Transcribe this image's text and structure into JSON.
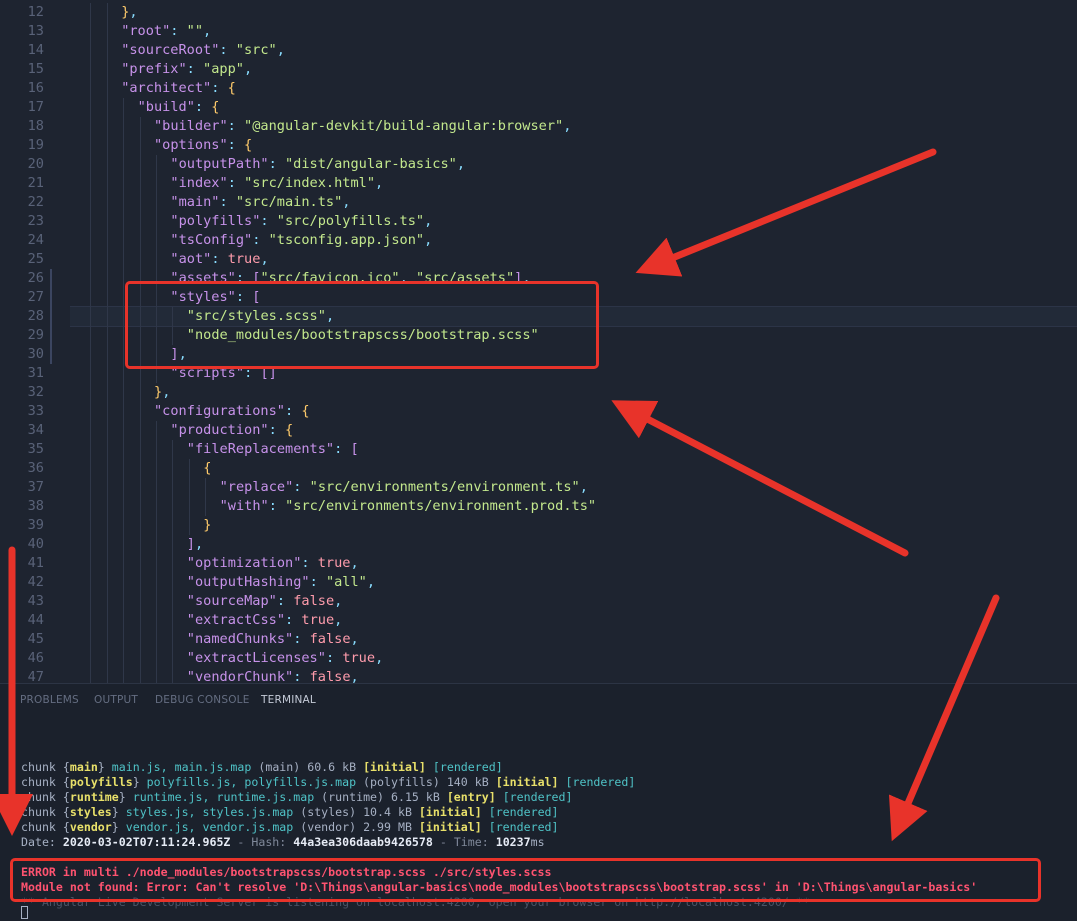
{
  "editor": {
    "lines": [
      {
        "n": "12",
        "html": "<span class='b'>}</span><span class='p'>,</span>",
        "indent": 3
      },
      {
        "n": "13",
        "html": "<span class='k'>\"root\"</span><span class='p'>:</span> <span class='s'>\"\"</span><span class='p'>,</span>",
        "indent": 3
      },
      {
        "n": "14",
        "html": "<span class='k'>\"sourceRoot\"</span><span class='p'>:</span> <span class='s'>\"src\"</span><span class='p'>,</span>",
        "indent": 3
      },
      {
        "n": "15",
        "html": "<span class='k'>\"prefix\"</span><span class='p'>:</span> <span class='s'>\"app\"</span><span class='p'>,</span>",
        "indent": 3
      },
      {
        "n": "16",
        "html": "<span class='k'>\"architect\"</span><span class='p'>:</span> <span class='b'>{</span>",
        "indent": 3
      },
      {
        "n": "17",
        "html": "<span class='k'>\"build\"</span><span class='p'>:</span> <span class='b'>{</span>",
        "indent": 4
      },
      {
        "n": "18",
        "html": "<span class='k'>\"builder\"</span><span class='p'>:</span> <span class='s'>\"@angular-devkit/build-angular:browser\"</span><span class='p'>,</span>",
        "indent": 5
      },
      {
        "n": "19",
        "html": "<span class='k'>\"options\"</span><span class='p'>:</span> <span class='b'>{</span>",
        "indent": 5
      },
      {
        "n": "20",
        "html": "<span class='k'>\"outputPath\"</span><span class='p'>:</span> <span class='s'>\"dist/angular-basics\"</span><span class='p'>,</span>",
        "indent": 6
      },
      {
        "n": "21",
        "html": "<span class='k'>\"index\"</span><span class='p'>:</span> <span class='s'>\"src/index.html\"</span><span class='p'>,</span>",
        "indent": 6
      },
      {
        "n": "22",
        "html": "<span class='k'>\"main\"</span><span class='p'>:</span> <span class='s'>\"src/main.ts\"</span><span class='p'>,</span>",
        "indent": 6
      },
      {
        "n": "23",
        "html": "<span class='k'>\"polyfills\"</span><span class='p'>:</span> <span class='s'>\"src/polyfills.ts\"</span><span class='p'>,</span>",
        "indent": 6
      },
      {
        "n": "24",
        "html": "<span class='k'>\"tsConfig\"</span><span class='p'>:</span> <span class='s'>\"tsconfig.app.json\"</span><span class='p'>,</span>",
        "indent": 6
      },
      {
        "n": "25",
        "html": "<span class='k'>\"aot\"</span><span class='p'>:</span> <span class='t'>true</span><span class='p'>,</span>",
        "indent": 6
      },
      {
        "n": "26",
        "html": "<span class='k'>\"assets\"</span><span class='p'>:</span> <span class='m'>[</span><span class='s'>\"src/favicon.ico\"</span><span class='p'>,</span> <span class='s'>\"src/assets\"</span><span class='m'>]</span><span class='p'>,</span>",
        "indent": 6
      },
      {
        "n": "27",
        "html": "<span class='k'>\"styles\"</span><span class='p'>:</span> <span class='m'>[</span>",
        "indent": 6
      },
      {
        "n": "28",
        "html": "<span class='s'>\"src/styles.scss\"</span><span class='p'>,</span>",
        "indent": 7
      },
      {
        "n": "29",
        "html": "<span class='s'>\"node_modules/bootstrapscss/bootstrap.scss\"</span>",
        "indent": 7
      },
      {
        "n": "30",
        "html": "<span class='m'>]</span><span class='p'>,</span>",
        "indent": 6
      },
      {
        "n": "31",
        "html": "<span class='k'>\"scripts\"</span><span class='p'>:</span> <span class='m'>[]</span>",
        "indent": 6
      },
      {
        "n": "32",
        "html": "<span class='b'>}</span><span class='p'>,</span>",
        "indent": 5
      },
      {
        "n": "33",
        "html": "<span class='k'>\"configurations\"</span><span class='p'>:</span> <span class='b'>{</span>",
        "indent": 5
      },
      {
        "n": "34",
        "html": "<span class='k'>\"production\"</span><span class='p'>:</span> <span class='b'>{</span>",
        "indent": 6
      },
      {
        "n": "35",
        "html": "<span class='k'>\"fileReplacements\"</span><span class='p'>:</span> <span class='m'>[</span>",
        "indent": 7
      },
      {
        "n": "36",
        "html": "<span class='b'>{</span>",
        "indent": 8
      },
      {
        "n": "37",
        "html": "<span class='k'>\"replace\"</span><span class='p'>:</span> <span class='s'>\"src/environments/environment.ts\"</span><span class='p'>,</span>",
        "indent": 9
      },
      {
        "n": "38",
        "html": "<span class='k'>\"with\"</span><span class='p'>:</span> <span class='s'>\"src/environments/environment.prod.ts\"</span>",
        "indent": 9
      },
      {
        "n": "39",
        "html": "<span class='b'>}</span>",
        "indent": 8
      },
      {
        "n": "40",
        "html": "<span class='m'>]</span><span class='p'>,</span>",
        "indent": 7
      },
      {
        "n": "41",
        "html": "<span class='k'>\"optimization\"</span><span class='p'>:</span> <span class='t'>true</span><span class='p'>,</span>",
        "indent": 7
      },
      {
        "n": "42",
        "html": "<span class='k'>\"outputHashing\"</span><span class='p'>:</span> <span class='s'>\"all\"</span><span class='p'>,</span>",
        "indent": 7
      },
      {
        "n": "43",
        "html": "<span class='k'>\"sourceMap\"</span><span class='p'>:</span> <span class='t'>false</span><span class='p'>,</span>",
        "indent": 7
      },
      {
        "n": "44",
        "html": "<span class='k'>\"extractCss\"</span><span class='p'>:</span> <span class='t'>true</span><span class='p'>,</span>",
        "indent": 7
      },
      {
        "n": "45",
        "html": "<span class='k'>\"namedChunks\"</span><span class='p'>:</span> <span class='t'>false</span><span class='p'>,</span>",
        "indent": 7
      },
      {
        "n": "46",
        "html": "<span class='k'>\"extractLicenses\"</span><span class='p'>:</span> <span class='t'>true</span><span class='p'>,</span>",
        "indent": 7
      },
      {
        "n": "47",
        "html": "<span class='k'>\"vendorChunk\"</span><span class='p'>:</span> <span class='t'>false</span><span class='p'>,</span>",
        "indent": 7
      }
    ]
  },
  "panel": {
    "tabs": [
      "PROBLEMS",
      "OUTPUT",
      "DEBUG CONSOLE",
      "TERMINAL"
    ],
    "active_tab": "TERMINAL"
  },
  "terminal": {
    "lines": [
      {
        "html": "chunk {<span class='ty'>main</span>} <span class='tc'>main.js, main.js.map</span> (main) 60.6 kB <span class='ty'>[initial]</span> <span class='tc'>[rendered]</span>"
      },
      {
        "html": "chunk {<span class='ty'>polyfills</span>} <span class='tc'>polyfills.js, polyfills.js.map</span> (polyfills) 140 kB <span class='ty'>[initial]</span> <span class='tc'>[rendered]</span>"
      },
      {
        "html": "chunk {<span class='ty'>runtime</span>} <span class='tc'>runtime.js, runtime.js.map</span> (runtime) 6.15 kB <span class='ty'>[entry]</span> <span class='tc'>[rendered]</span>"
      },
      {
        "html": "chunk {<span class='ty'>styles</span>} <span class='tc'>styles.js, styles.js.map</span> (styles) 10.4 kB <span class='ty'>[initial]</span> <span class='tc'>[rendered]</span>"
      },
      {
        "html": "chunk {<span class='ty'>vendor</span>} <span class='tc'>vendor.js, vendor.js.map</span> (vendor) 2.99 MB <span class='ty'>[initial]</span> <span class='tc'>[rendered]</span>"
      },
      {
        "html": "Date: <span class='tw'>2020-03-02T07:11:24.965Z</span> <span class='tg'>- Hash:</span> <span class='tw'>44a3ea306daab9426578</span> <span class='tg'>- Time:</span> <span class='tw'>10237</span>ms"
      },
      {
        "html": ""
      },
      {
        "html": "<span class='terr'>ERROR in multi ./node_modules/bootstrapscss/bootstrap.scss ./src/styles.scss</span>"
      },
      {
        "html": "<span class='terr'>Module not found: Error: Can't resolve 'D:\\Things\\angular-basics\\node_modules\\bootstrapscss\\bootstrap.scss' in 'D:\\Things\\angular-basics'</span>"
      },
      {
        "html": "** Angular Live Development Server is listening on localhost:4200, open your browser on http://localhost:4200/ **"
      }
    ]
  },
  "colors": {
    "annotation": "#e8332a",
    "background": "#1e2430"
  }
}
